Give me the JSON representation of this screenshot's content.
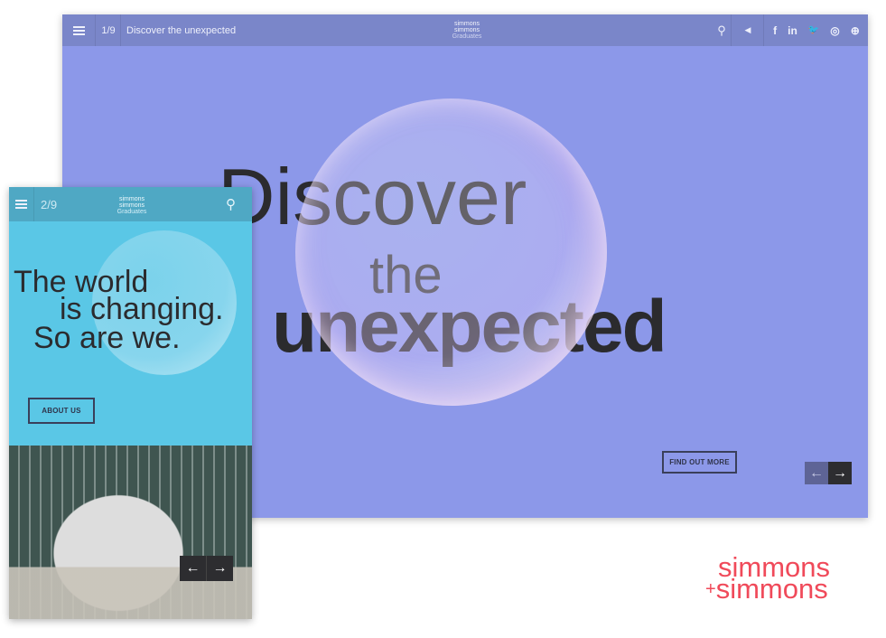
{
  "desktop": {
    "page_counter": "1/9",
    "page_title": "Discover the unexpected",
    "logo": {
      "line1": "simmons",
      "line2": "simmons",
      "line3": "Graduates"
    },
    "social": [
      "f",
      "in",
      "🐦",
      "◎",
      "⊕"
    ],
    "hero": {
      "line1": "Discover",
      "line2": "the",
      "line3": "unexpected"
    },
    "cta": "FIND OUT MORE",
    "prev": "←",
    "next": "→"
  },
  "mobile": {
    "page_counter": "2/9",
    "logo": {
      "line1": "simmons",
      "line2": "simmons",
      "line3": "Graduates"
    },
    "hero": {
      "line1": "The world",
      "line2": "is changing.",
      "line3": "So are we."
    },
    "cta": "ABOUT US",
    "prev": "←",
    "next": "→"
  },
  "brand": {
    "line1": "simmons",
    "line2": "simmons",
    "plus": "+"
  },
  "colors": {
    "desktop_bg": "#8c98e9",
    "desktop_bar": "#7a86c9",
    "mobile_bg": "#5ac7e6",
    "mobile_bar": "#4fa8c4",
    "brand": "#f04a5a"
  }
}
